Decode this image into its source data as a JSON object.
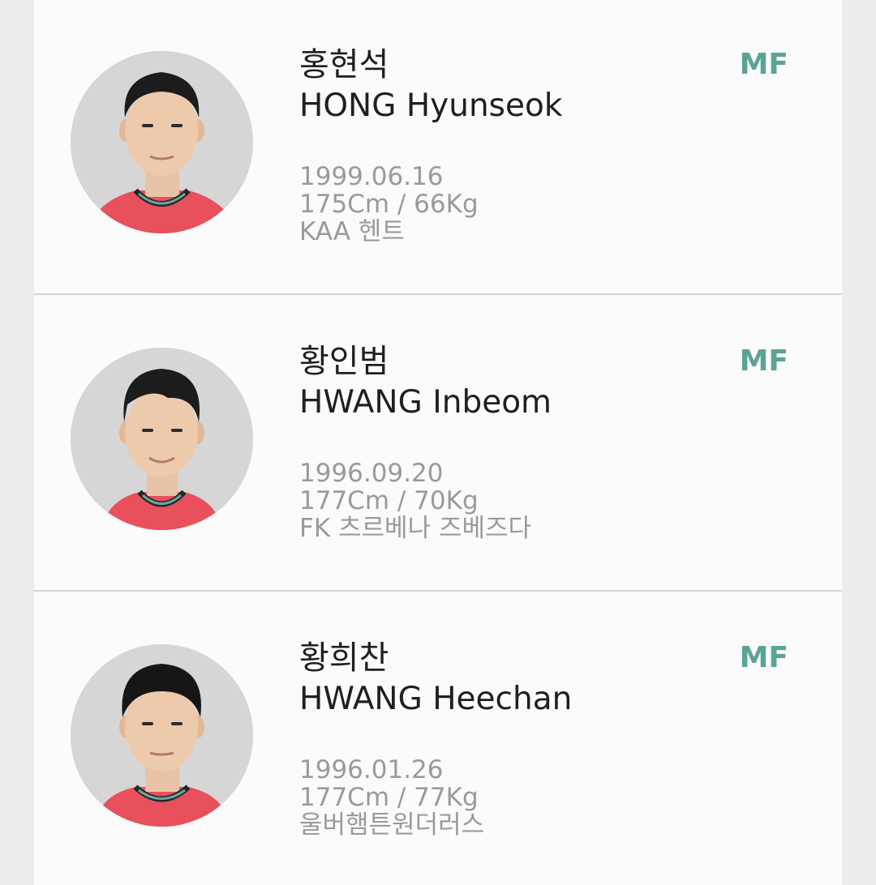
{
  "players": [
    {
      "name_ko": "홍현석",
      "name_en": "HONG Hyunseok",
      "birth": "1999.06.16",
      "body": "175Cm / 66Kg",
      "club": "KAA 헨트",
      "position": "MF"
    },
    {
      "name_ko": "황인범",
      "name_en": "HWANG Inbeom",
      "birth": "1996.09.20",
      "body": "177Cm / 70Kg",
      "club": "FK 츠르베나 즈베즈다",
      "position": "MF"
    },
    {
      "name_ko": "황희찬",
      "name_en": "HWANG Heechan",
      "birth": "1996.01.26",
      "body": "177Cm / 77Kg",
      "club": "울버햄튼원더러스",
      "position": "MF"
    }
  ],
  "colors": {
    "position_accent": "#5aa495",
    "meta_text": "#9a9a9a",
    "jersey": "#e8505b"
  }
}
